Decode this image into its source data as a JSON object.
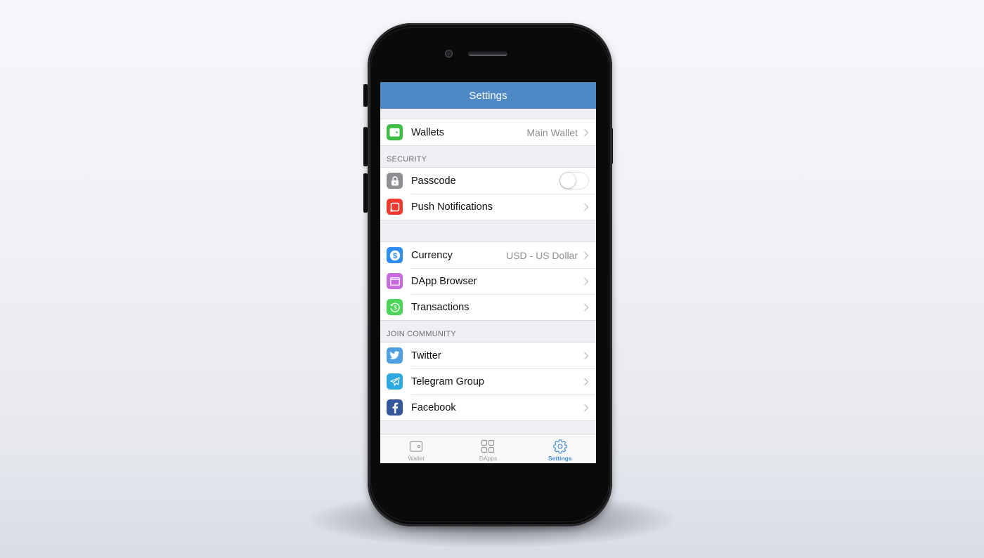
{
  "screen": {
    "title": "Settings",
    "accent_color": "#4e88c5",
    "groups": [
      {
        "header": "",
        "items": [
          {
            "label": "Wallets",
            "value": "Main Wallet",
            "icon": "wallet-icon",
            "icon_color": "#3ebc45",
            "accessory": "chevron"
          }
        ]
      },
      {
        "header": "SECURITY",
        "items": [
          {
            "label": "Passcode",
            "value": "",
            "icon": "lock-icon",
            "icon_color": "#8e8e93",
            "accessory": "toggle",
            "toggle_on": false
          },
          {
            "label": "Push Notifications",
            "value": "",
            "icon": "notification-icon",
            "icon_color": "#ef3b2f",
            "accessory": "chevron"
          }
        ]
      },
      {
        "header": "",
        "items": [
          {
            "label": "Currency",
            "value": "USD - US Dollar",
            "icon": "dollar-icon",
            "icon_color": "#2f8cf0",
            "accessory": "chevron"
          },
          {
            "label": "DApp Browser",
            "value": "",
            "icon": "browser-icon",
            "icon_color": "#c86be0",
            "accessory": "chevron"
          },
          {
            "label": "Transactions",
            "value": "",
            "icon": "transactions-icon",
            "icon_color": "#4cd45a",
            "accessory": "chevron"
          }
        ]
      },
      {
        "header": "JOIN COMMUNITY",
        "items": [
          {
            "label": "Twitter",
            "value": "",
            "icon": "twitter-icon",
            "icon_color": "#4f9fe0",
            "accessory": "chevron"
          },
          {
            "label": "Telegram Group",
            "value": "",
            "icon": "telegram-icon",
            "icon_color": "#2ea8e0",
            "accessory": "chevron"
          },
          {
            "label": "Facebook",
            "value": "",
            "icon": "facebook-icon",
            "icon_color": "#37579c",
            "accessory": "chevron"
          }
        ]
      }
    ]
  },
  "tabbar": {
    "tabs": [
      {
        "label": "Wallet",
        "icon": "wallet-tab-icon",
        "active": false
      },
      {
        "label": "DApps",
        "icon": "grid-icon",
        "active": false
      },
      {
        "label": "Settings",
        "icon": "gear-icon",
        "active": true
      }
    ],
    "active_color": "#3f8ad6"
  }
}
